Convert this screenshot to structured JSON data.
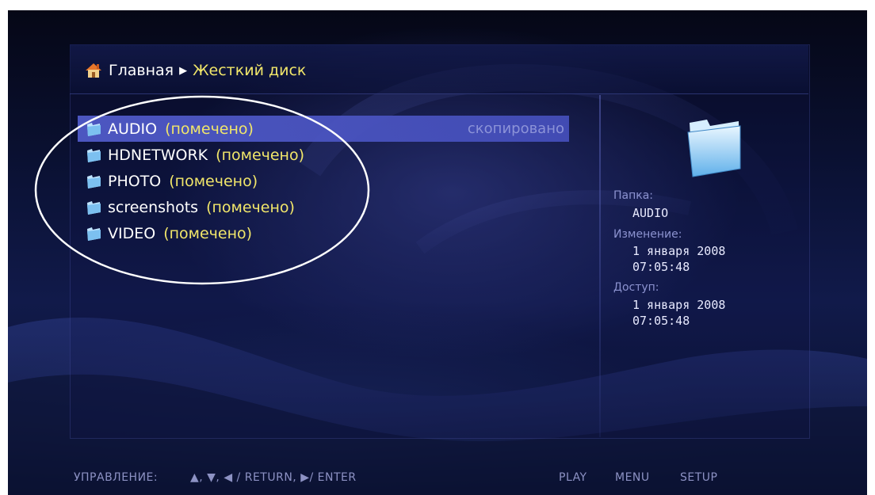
{
  "breadcrumb": {
    "home": "Главная",
    "current": "Жесткий диск"
  },
  "files": [
    {
      "name": "AUDIO",
      "tag": "(помечено)",
      "status": "скопировано",
      "selected": true
    },
    {
      "name": "HDNETWORK",
      "tag": "(помечено)",
      "status": "",
      "selected": false
    },
    {
      "name": "PHOTO",
      "tag": "(помечено)",
      "status": "",
      "selected": false
    },
    {
      "name": "screenshots",
      "tag": "(помечено)",
      "status": "",
      "selected": false
    },
    {
      "name": "VIDEO",
      "tag": "(помечено)",
      "status": "",
      "selected": false
    }
  ],
  "info": {
    "folder_label": "Папка:",
    "folder_value": "AUDIO",
    "modified_label": "Изменение:",
    "modified_date": "1 января 2008",
    "modified_time": "07:05:48",
    "access_label": "Доступ:",
    "access_date": "1 января 2008",
    "access_time": "07:05:48"
  },
  "footer": {
    "controls_label": "УПРАВЛЕНИЕ:",
    "controls_keys": "▲, ▼, ◀ / RETURN, ▶/ ENTER",
    "play": "PLAY",
    "menu": "MENU",
    "setup": "SETUP"
  },
  "colors": {
    "accent_yellow": "#f1e66a",
    "selection_blue": "#5058c8",
    "status_text": "#8c93d8",
    "background": "#0b1236"
  },
  "icons": {
    "home": "home-icon",
    "breadcrumb_separator": "triangle-right-icon",
    "folder": "folder-icon"
  }
}
